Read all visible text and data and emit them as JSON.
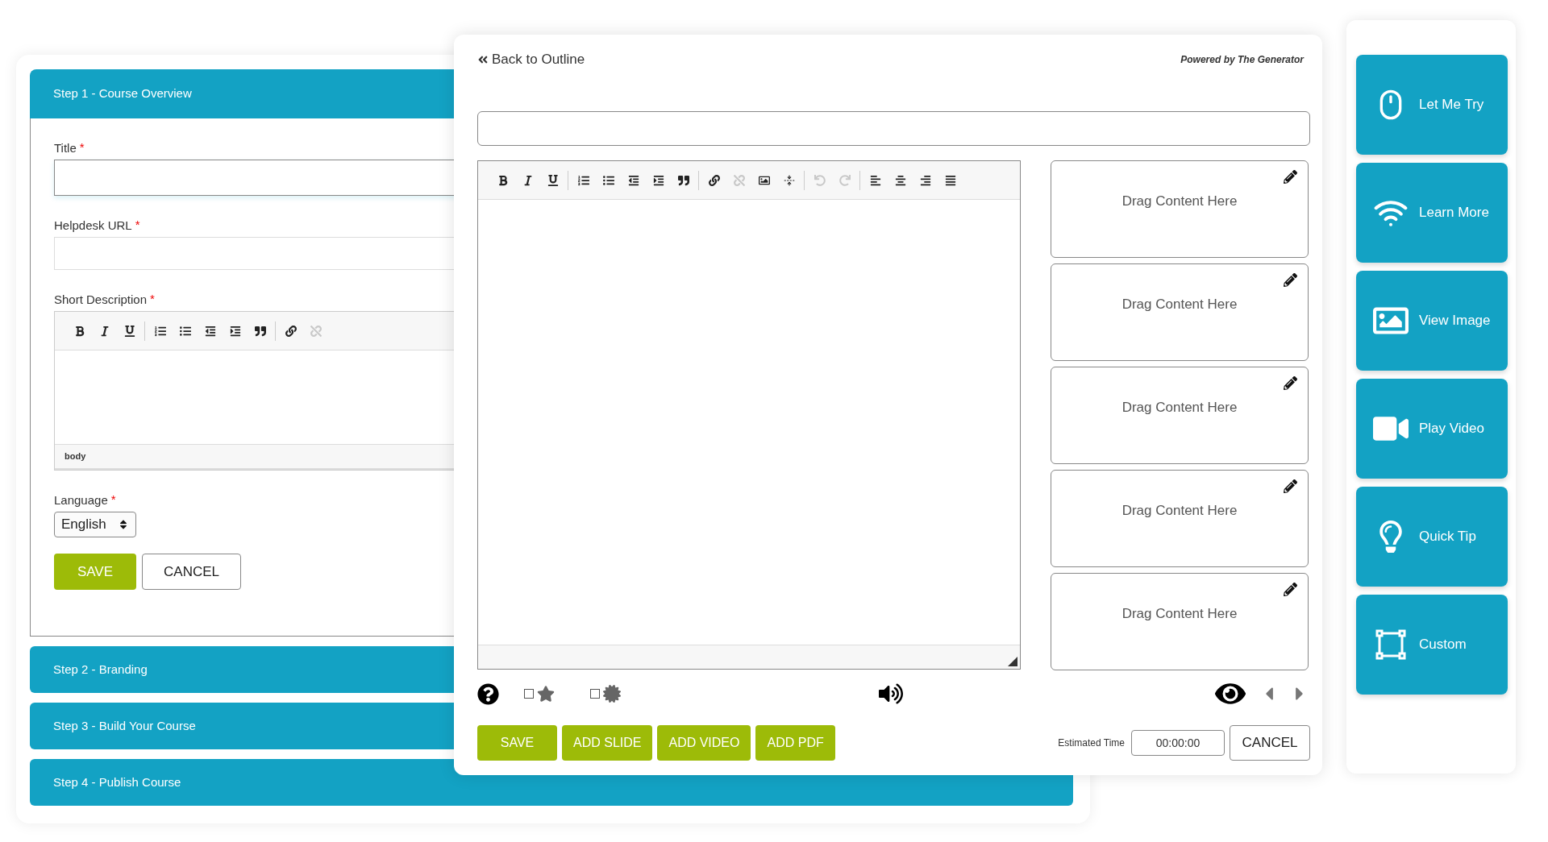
{
  "course_panel": {
    "steps": [
      {
        "label": "Step 1 - Course Overview",
        "expanded": true
      },
      {
        "label": "Step 2 - Branding",
        "expanded": false
      },
      {
        "label": "Step 3 - Build Your Course",
        "expanded": false
      },
      {
        "label": "Step 4 - Publish Course",
        "expanded": false
      }
    ],
    "fields": [
      {
        "kind": "text",
        "label": "Title",
        "mark": "*"
      },
      {
        "kind": "text",
        "label": "Helpdesk URL",
        "mark": "*"
      },
      {
        "kind": "editor",
        "label": "Short Description",
        "mark": "*",
        "toolbar": [
          [
            {
              "kind": "bold",
              "disabled": false
            },
            {
              "kind": "italic",
              "disabled": false
            },
            {
              "kind": "underline",
              "disabled": false
            }
          ],
          [
            {
              "kind": "ordered-list",
              "disabled": false
            },
            {
              "kind": "bullet-list",
              "disabled": false
            },
            {
              "kind": "outdent",
              "disabled": false
            },
            {
              "kind": "indent",
              "disabled": false
            },
            {
              "kind": "quote",
              "disabled": false
            }
          ],
          [
            {
              "kind": "link",
              "disabled": false
            },
            {
              "kind": "unlink",
              "disabled": true
            }
          ]
        ],
        "status": "body"
      },
      {
        "kind": "select",
        "label": "Language",
        "mark": "*",
        "value": "English"
      }
    ],
    "buttons": [
      {
        "label": "SAVE",
        "kind": "primary"
      },
      {
        "label": "CANCEL",
        "kind": "secondary"
      }
    ]
  },
  "slide_editor": {
    "back_link": "Back to Outline",
    "powered_by": "Powered by The Generator",
    "toolbar": [
      [
        {
          "kind": "bold",
          "disabled": false
        },
        {
          "kind": "italic",
          "disabled": false
        },
        {
          "kind": "underline",
          "disabled": false
        }
      ],
      [
        {
          "kind": "ordered-list",
          "disabled": false
        },
        {
          "kind": "bullet-list",
          "disabled": false
        },
        {
          "kind": "outdent",
          "disabled": false
        },
        {
          "kind": "indent",
          "disabled": false
        },
        {
          "kind": "quote",
          "disabled": false
        }
      ],
      [
        {
          "kind": "link",
          "disabled": false
        },
        {
          "kind": "unlink",
          "disabled": true
        },
        {
          "kind": "image",
          "disabled": false
        },
        {
          "kind": "page-break",
          "disabled": false
        }
      ],
      [
        {
          "kind": "undo",
          "disabled": true
        },
        {
          "kind": "redo",
          "disabled": true
        }
      ],
      [
        {
          "kind": "align-left",
          "disabled": false
        },
        {
          "kind": "align-center",
          "disabled": false
        },
        {
          "kind": "align-right",
          "disabled": false
        },
        {
          "kind": "align-justify",
          "disabled": false
        }
      ]
    ],
    "drop_zones": [
      "Drag Content Here",
      "Drag Content Here",
      "Drag Content Here",
      "Drag Content Here",
      "Drag Content Here"
    ],
    "options": [
      {
        "kind": "star",
        "checked": false
      },
      {
        "kind": "badge",
        "checked": false
      }
    ],
    "buttons": [
      "SAVE",
      "ADD SLIDE",
      "ADD VIDEO",
      "ADD PDF"
    ],
    "estimated_time": {
      "label": "Estimated Time",
      "value": "00:00:00"
    },
    "cancel": "CANCEL"
  },
  "interactions": [
    {
      "kind": "mouse",
      "label": "Let Me Try"
    },
    {
      "kind": "waves",
      "label": "Learn More"
    },
    {
      "kind": "image",
      "label": "View Image"
    },
    {
      "kind": "video",
      "label": "Play Video"
    },
    {
      "kind": "bulb",
      "label": "Quick Tip"
    },
    {
      "kind": "frame",
      "label": "Custom"
    }
  ]
}
